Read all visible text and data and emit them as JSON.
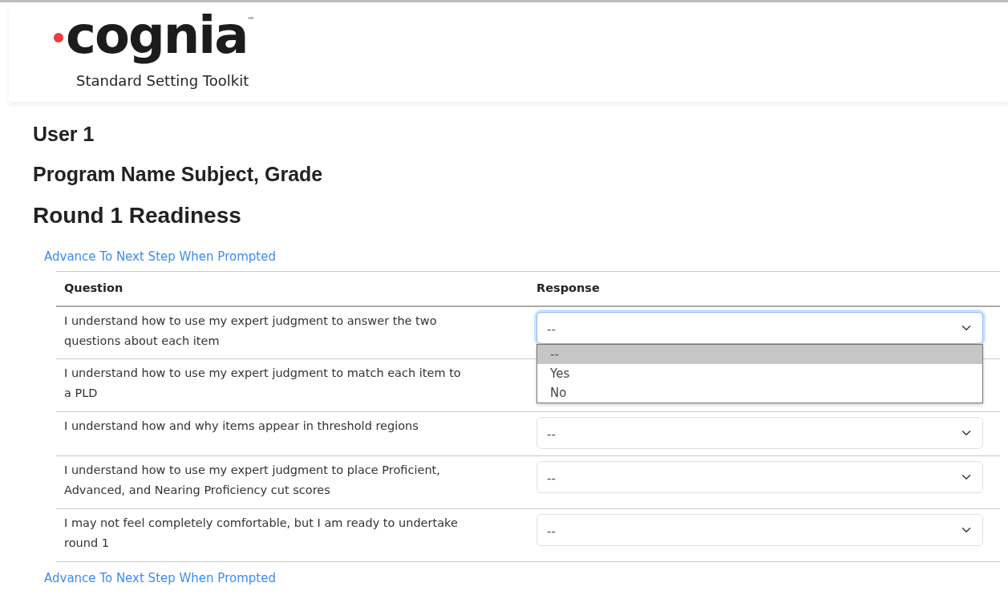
{
  "header": {
    "logo": "cognia",
    "trademark": "™",
    "subtitle": "Standard Setting Toolkit"
  },
  "headings": [
    "User 1",
    "Program Name Subject, Grade",
    "Round 1 Readiness"
  ],
  "top_link": "Advance To Next Step When Prompted",
  "table": {
    "columns": [
      "Question",
      "Response"
    ],
    "rows": [
      {
        "question": "I understand how to use my expert judgment to answer the two questions about each item",
        "response": "--",
        "focused": true
      },
      {
        "question": "I understand how to use my expert judgment to match each item to a PLD"
      },
      {
        "question": "I understand how and why items appear in threshold regions",
        "response": "--",
        "focused": false
      },
      {
        "question": "I understand how to use my expert judgment to place Proficient, Advanced, and Nearing Proficiency cut scores",
        "response": "--",
        "focused": false
      },
      {
        "question": "I may not feel completely comfortable, but I am ready to undertake round 1",
        "response": "--",
        "focused": false
      }
    ]
  },
  "dropdown": {
    "options": [
      {
        "label": "--",
        "selected": true
      },
      {
        "label": "Yes",
        "selected": false
      },
      {
        "label": "No",
        "selected": false
      }
    ]
  },
  "bottom_link": "Advance To Next Step When Prompted"
}
